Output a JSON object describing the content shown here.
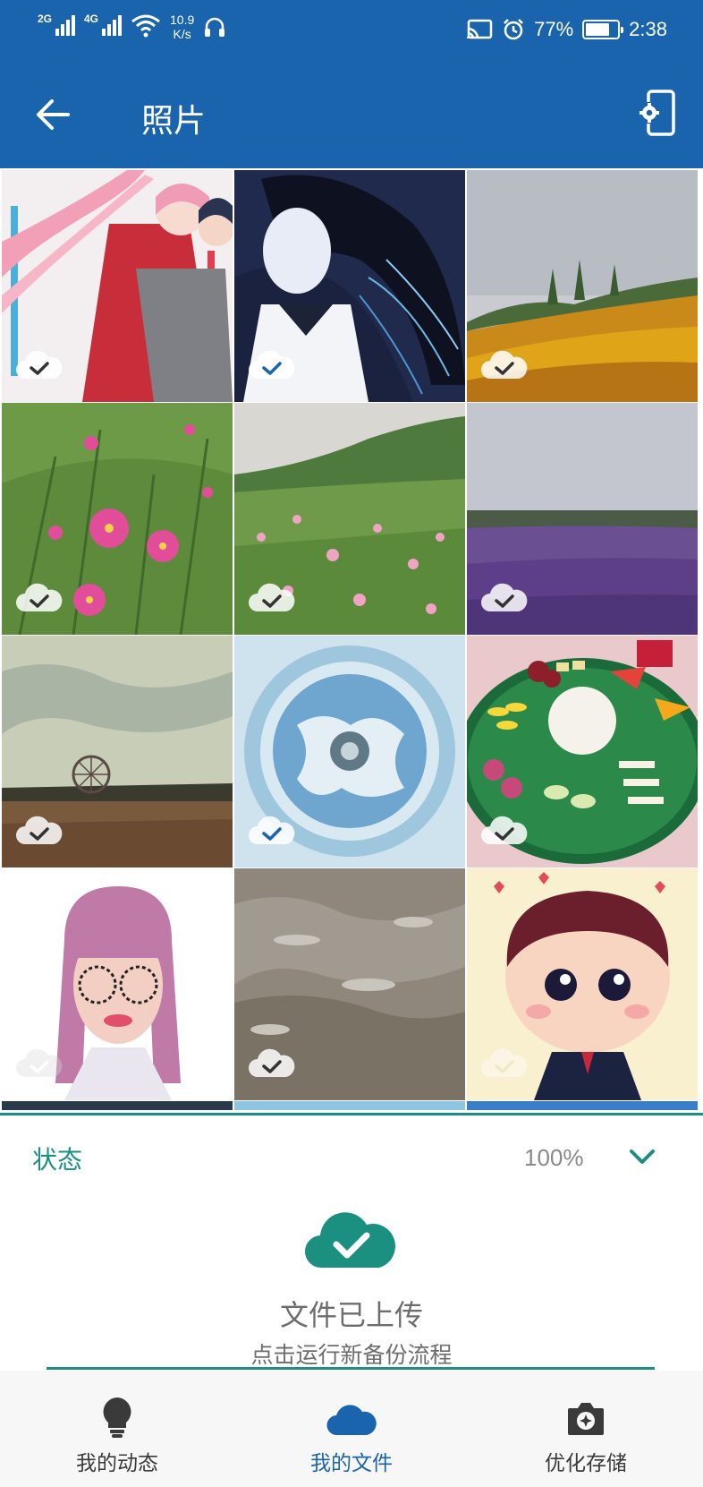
{
  "status_bar": {
    "signal_1": "2G",
    "signal_2": "4G",
    "speed_value": "10.9",
    "speed_unit": "K/s",
    "battery": "77%",
    "battery_level": 0.77,
    "time": "2:38",
    "icons": [
      "signal-icon",
      "wifi-icon",
      "headset-icon",
      "cast-icon",
      "alarm-icon",
      "battery-icon"
    ]
  },
  "app_bar": {
    "title": "照片",
    "icons": [
      "back-arrow-icon",
      "device-settings-icon"
    ]
  },
  "photos": {
    "count": 12,
    "items": [
      {
        "subject": "anime-pink-hair",
        "synced": true,
        "visible": "partial"
      },
      {
        "subject": "anime-dark-hair",
        "synced": true
      },
      {
        "subject": "flower-field-sky",
        "synced": true
      },
      {
        "subject": "pink-cosmos-close",
        "synced": true
      },
      {
        "subject": "cosmos-field",
        "synced": true
      },
      {
        "subject": "lavender-field",
        "synced": true
      },
      {
        "subject": "ferris-wheel-field",
        "synced": true
      },
      {
        "subject": "dome-ceiling",
        "synced": true
      },
      {
        "subject": "fruit-platter",
        "synced": true
      },
      {
        "subject": "cartoon-girl",
        "synced": true,
        "visible": "faint"
      },
      {
        "subject": "fish-water",
        "synced": true
      },
      {
        "subject": "cartoon-boy",
        "synced": true,
        "visible": "faint"
      }
    ]
  },
  "status_panel": {
    "label": "状态",
    "percent": "100%",
    "progress": 1.0,
    "message": "文件已上传",
    "sub_message": "点击运行新备份流程",
    "accent": "#1b8f80"
  },
  "bottom_nav": {
    "items": [
      {
        "label": "我的动态",
        "icon": "lightbulb-icon"
      },
      {
        "label": "我的文件",
        "icon": "cloud-icon",
        "active": true
      },
      {
        "label": "优化存储",
        "icon": "camera-icon"
      }
    ]
  },
  "colors": {
    "primary": "#1a64ad",
    "accent": "#1b8f80"
  }
}
